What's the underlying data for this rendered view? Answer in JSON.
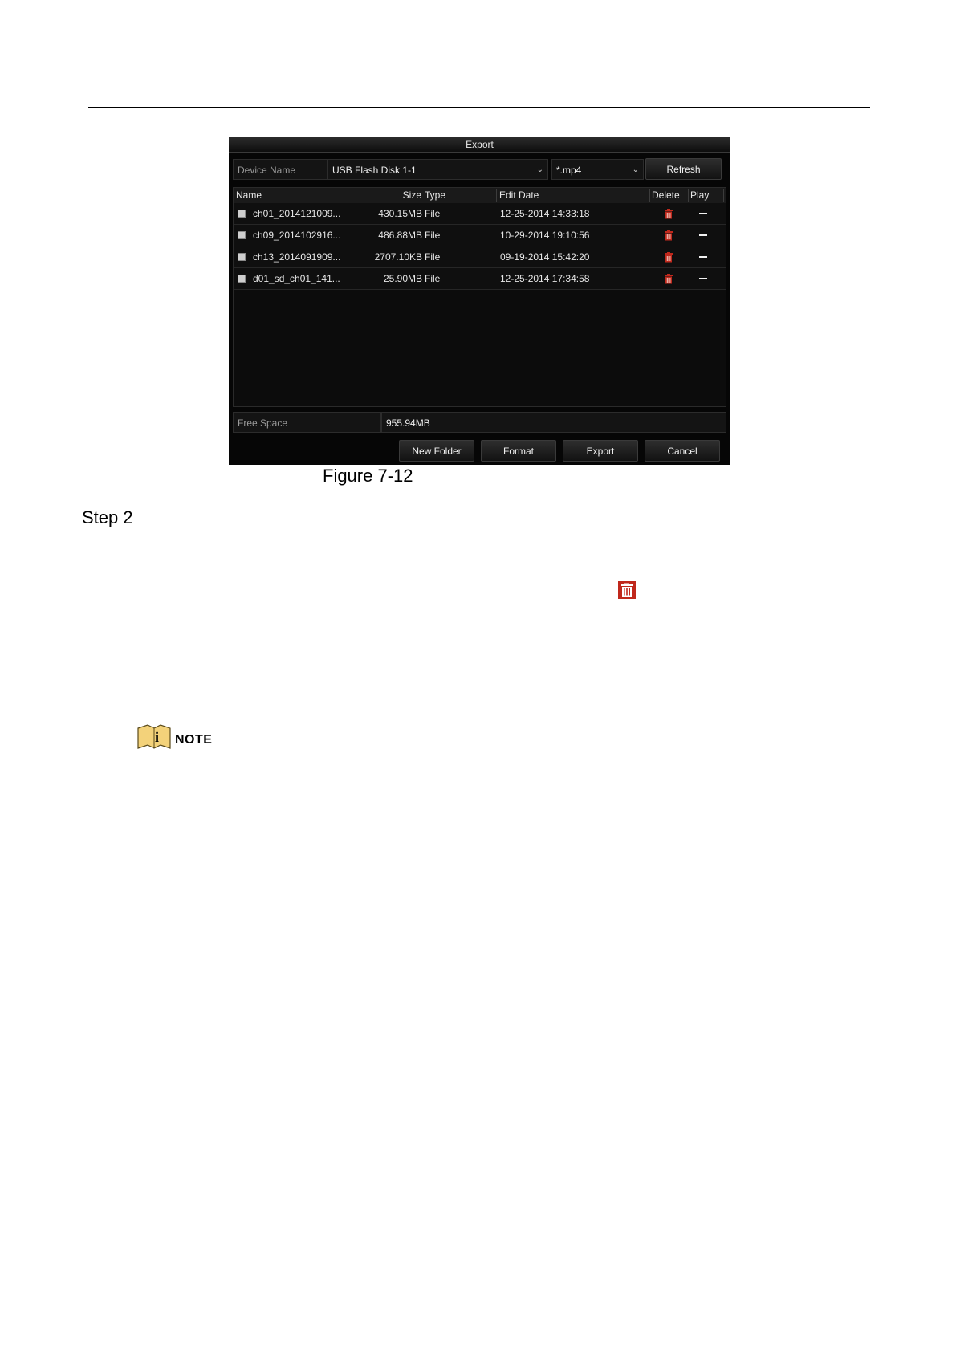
{
  "dialog": {
    "title": "Export",
    "device_label": "Device Name",
    "device_value": "USB Flash Disk 1-1",
    "filter_value": "*.mp4",
    "refresh_label": "Refresh",
    "columns": {
      "name": "Name",
      "size": "Size",
      "type": "Type",
      "edit_date": "Edit Date",
      "delete": "Delete",
      "play": "Play"
    },
    "files": [
      {
        "name": "ch01_2014121009...",
        "size": "430.15MB",
        "type": "File",
        "edit_date": "12-25-2014 14:33:18"
      },
      {
        "name": "ch09_2014102916...",
        "size": "486.88MB",
        "type": "File",
        "edit_date": "10-29-2014 19:10:56"
      },
      {
        "name": "ch13_2014091909...",
        "size": "2707.10KB",
        "type": "File",
        "edit_date": "09-19-2014 15:42:20"
      },
      {
        "name": "d01_sd_ch01_141...",
        "size": "25.90MB",
        "type": "File",
        "edit_date": "12-25-2014 17:34:58"
      }
    ],
    "free_space_label": "Free Space",
    "free_space_value": "955.94MB",
    "buttons": {
      "new_folder": "New Folder",
      "format": "Format",
      "export": "Export",
      "cancel": "Cancel"
    }
  },
  "caption": "Figure 7-12",
  "step_label": "Step 2",
  "note_label": "NOTE",
  "icons": {
    "delete": "trash-icon",
    "play": "dash-icon",
    "note": "note-book-icon"
  },
  "colors": {
    "dialog_bg": "#060606",
    "trash_red": "#c0281c",
    "note_yellow": "#f3d27a"
  }
}
